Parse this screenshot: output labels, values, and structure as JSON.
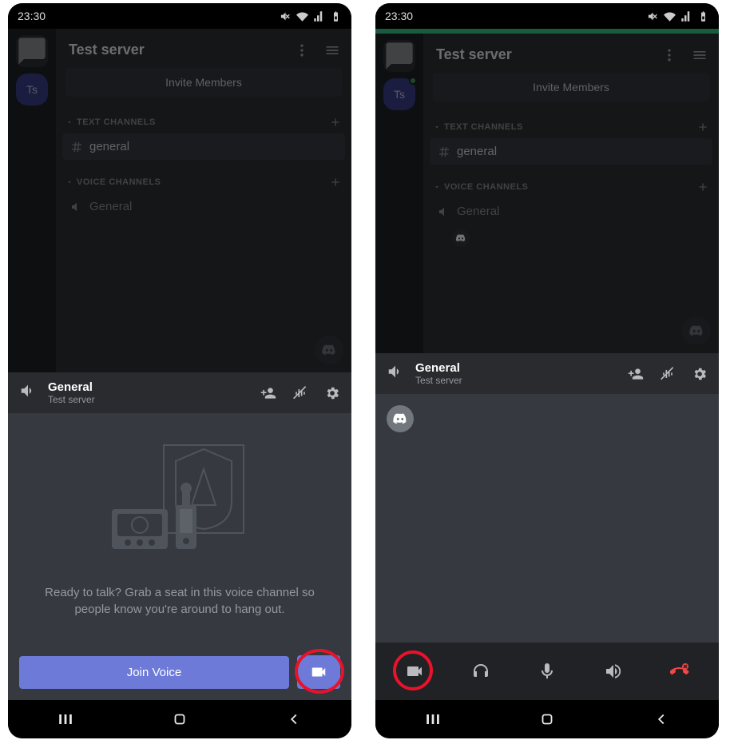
{
  "status": {
    "time": "23:30"
  },
  "server": {
    "title": "Test server",
    "badge": "Ts",
    "invite_label": "Invite Members",
    "sections": {
      "text_header": "TEXT CHANNELS",
      "voice_header": "VOICE CHANNELS",
      "text_channel": "general",
      "voice_channel": "General"
    }
  },
  "voice_panel": {
    "channel": "General",
    "server": "Test server",
    "prompt_line1": "Ready to talk? Grab a seat in this voice channel so",
    "prompt_line2": "people know you're around to hang out.",
    "join_label": "Join Voice"
  }
}
